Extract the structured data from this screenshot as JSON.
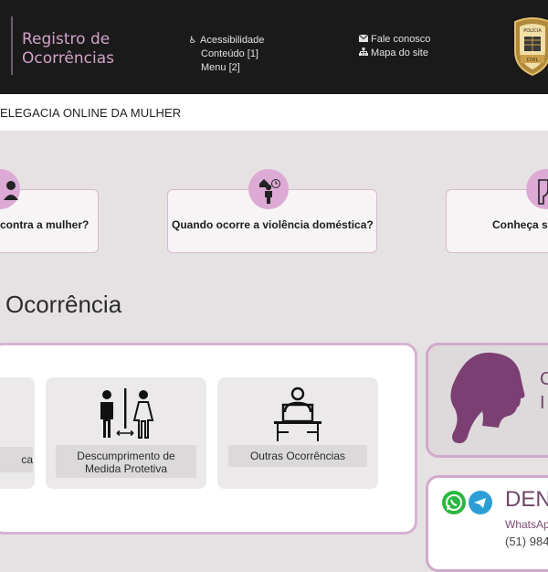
{
  "header": {
    "site_title_line1": "Registro de",
    "site_title_line2": "Ocorrências",
    "accessibility_label": "Acessibilidade",
    "content_link": "Conteúdo [1]",
    "menu_link": "Menu [2]",
    "contact_link": "Fale conosco",
    "sitemap_link": "Mapa do site",
    "badge_text_top": "POLÍCIA",
    "badge_text_bottom": "CIVIL"
  },
  "breadcrumb": {
    "text": "ELEGACIA ONLINE DA MULHER"
  },
  "questions": [
    {
      "label": "contra a mulher?",
      "icon": "woman-user-icon"
    },
    {
      "label": "Quando ocorre a violência doméstica?",
      "icon": "domestic-violence-icon"
    },
    {
      "label": "Conheça s",
      "icon": "fist-icon"
    }
  ],
  "section": {
    "title": "Ocorrência"
  },
  "tiles": [
    {
      "label": "ca",
      "icon": ""
    },
    {
      "label_line1": "Descumprimento de",
      "label_line2": "Medida Protetiva",
      "icon": "restroom-separation-icon"
    },
    {
      "label": "Outras Ocorrências",
      "icon": "desk-computer-user-icon"
    }
  ],
  "side_card": {
    "line1": "C",
    "line2": "I",
    "icon": "woman-profile-icon"
  },
  "denuncia": {
    "title": "DEN",
    "subtitle": "WhatsAp",
    "phone": "(51) 984",
    "icons": [
      "whatsapp-icon",
      "telegram-icon"
    ]
  },
  "colors": {
    "accent_pink": "#d2a2c8",
    "accent_purple": "#6f4569",
    "header_bg": "#1b1a1b",
    "page_bg": "#e6e2e3"
  }
}
